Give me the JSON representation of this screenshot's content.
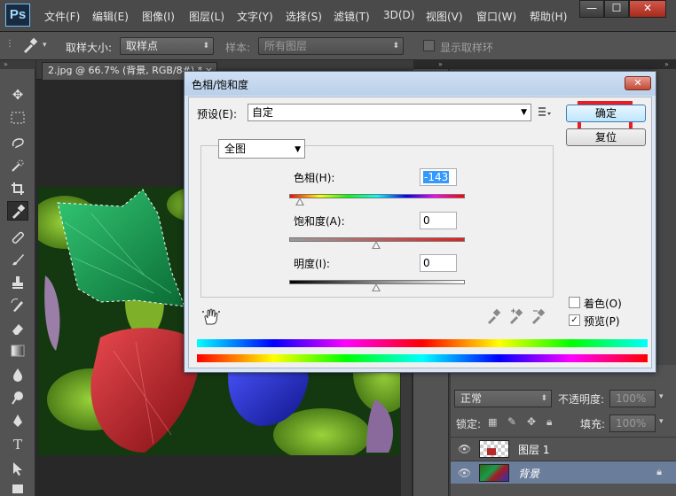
{
  "app": {
    "logo": "Ps",
    "menu": [
      "文件(F)",
      "编辑(E)",
      "图像(I)",
      "图层(L)",
      "文字(Y)",
      "选择(S)",
      "滤镜(T)",
      "3D(D)",
      "视图(V)",
      "窗口(W)",
      "帮助(H)"
    ],
    "window_controls": {
      "minimize": "—",
      "maximize": "☐",
      "close": "✕"
    }
  },
  "options_bar": {
    "sample_size_label": "取样大小:",
    "sample_size_value": "取样点",
    "sample_label": "样本:",
    "sample_value": "所有图层",
    "show_ring_label": "显示取样环"
  },
  "document": {
    "tab_title": "2.jpg @ 66.7% (背景, RGB/8#) *",
    "tab_close": "×"
  },
  "dialog": {
    "title": "色相/饱和度",
    "close": "✕",
    "preset_label": "预设(E):",
    "preset_value": "自定",
    "ok_label": "确定",
    "reset_label": "复位",
    "channel_value": "全图",
    "hue": {
      "label": "色相(H):",
      "value": "-143"
    },
    "saturation": {
      "label": "饱和度(A):",
      "value": "0"
    },
    "lightness": {
      "label": "明度(I):",
      "value": "0"
    },
    "colorize_label": "着色(O)",
    "colorize_checked": false,
    "preview_label": "预览(P)",
    "preview_checked": true,
    "preview_check_glyph": "✓"
  },
  "layers_panel": {
    "blend_mode": "正常",
    "opacity_label": "不透明度:",
    "opacity_value": "100%",
    "lock_label": "锁定:",
    "fill_label": "填充:",
    "fill_value": "100%",
    "layers": [
      {
        "name": "图层 1",
        "selected": false,
        "locked": false
      },
      {
        "name": "背景",
        "selected": true,
        "locked": true
      }
    ]
  },
  "colors": {
    "accent_highlight": "#ec1c24",
    "dialog_bg": "#f0f0f0",
    "ps_dark": "#535353"
  }
}
